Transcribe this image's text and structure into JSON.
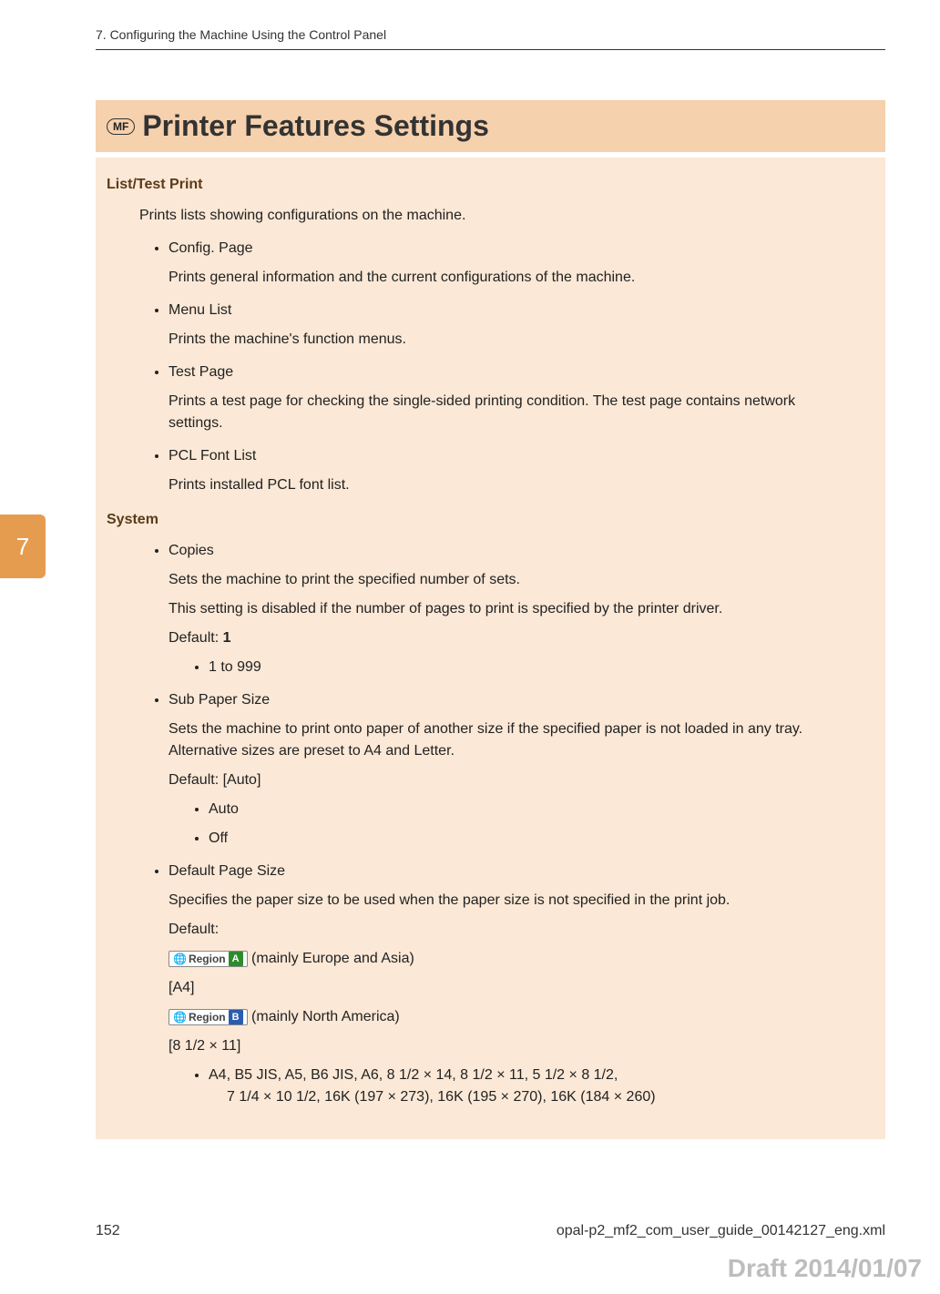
{
  "header": "7. Configuring the Machine Using the Control Panel",
  "mf_label": "MF",
  "title": "Printer Features Settings",
  "side_tab": "7",
  "sections": {
    "list_test": {
      "heading": "List/Test Print",
      "intro": "Prints lists showing configurations on the machine.",
      "items": [
        {
          "title": "Config. Page",
          "desc": "Prints general information and the current configurations of the machine."
        },
        {
          "title": "Menu List",
          "desc": "Prints the machine's function menus."
        },
        {
          "title": "Test Page",
          "desc": "Prints a test page for checking the single-sided printing condition. The test page contains network settings."
        },
        {
          "title": "PCL Font List",
          "desc": "Prints installed PCL font list."
        }
      ]
    },
    "system": {
      "heading": "System",
      "items": {
        "copies": {
          "title": "Copies",
          "desc1": "Sets the machine to print the specified number of sets.",
          "desc2": "This setting is disabled if the number of pages to print is specified by the printer driver.",
          "default_label": "Default: ",
          "default_value": "1",
          "range": "1 to 999"
        },
        "sub_paper": {
          "title": "Sub Paper Size",
          "desc": "Sets the machine to print onto paper of another size if the specified paper is not loaded in any tray. Alternative sizes are preset to A4 and Letter.",
          "default": "Default: [Auto]",
          "opts": [
            "Auto",
            "Off"
          ]
        },
        "default_page": {
          "title": "Default Page Size",
          "desc": "Specifies the paper size to be used when the paper size is not specified in the print job.",
          "default_label": "Default:",
          "region_word": "Region",
          "region_a_note": " (mainly Europe and Asia)",
          "region_a_val": "[A4]",
          "region_b_note": " (mainly North America)",
          "region_b_val": "[8 1/2 × 11]",
          "sizes_line1": "A4, B5 JIS, A5, B6 JIS, A6, 8 1/2 × 14, 8 1/2 × 11, 5 1/2 × 8 1/2,",
          "sizes_line2": "7 1/4 × 10 1/2, 16K (197 × 273), 16K (195 × 270), 16K (184 × 260)"
        }
      }
    }
  },
  "footer": {
    "page_num": "152",
    "file": "opal-p2_mf2_com_user_guide_00142127_eng.xml"
  },
  "draft": "Draft 2014/01/07"
}
